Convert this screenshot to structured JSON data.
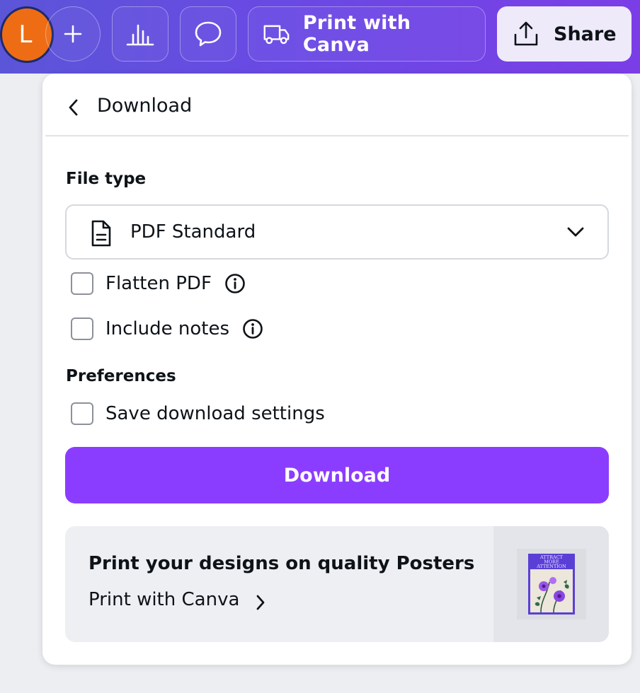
{
  "topbar": {
    "avatar_initial": "L",
    "print_label": "Print with Canva",
    "share_label": "Share",
    "icons": [
      "plus-icon",
      "bar-chart-icon",
      "comment-icon",
      "truck-icon",
      "share-upload-icon"
    ]
  },
  "panel": {
    "title": "Download",
    "file_type_label": "File type",
    "file_type_value": "PDF Standard",
    "options": [
      {
        "label": "Flatten PDF",
        "checked": false,
        "info": true
      },
      {
        "label": "Include notes",
        "checked": false,
        "info": true
      }
    ],
    "preferences_label": "Preferences",
    "preferences": [
      {
        "label": "Save download settings",
        "checked": false
      }
    ],
    "download_button": "Download",
    "promo": {
      "title": "Print your designs on quality Posters",
      "link": "Print with Canva",
      "poster_text": [
        "ATTRACT",
        "MORE",
        "ATTENTION"
      ]
    }
  },
  "colors": {
    "accent": "#8b3dff",
    "avatar": "#ee6d14",
    "topbar_start": "#5b55d8",
    "topbar_end": "#7b3ee6"
  }
}
